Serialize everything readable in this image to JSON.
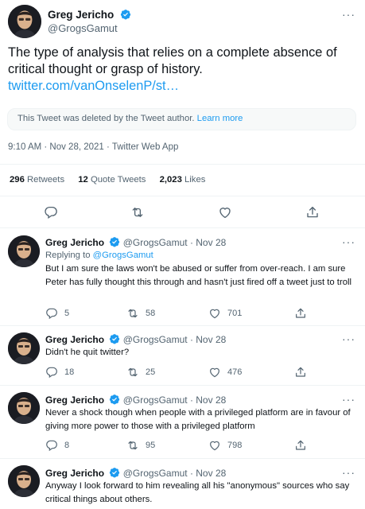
{
  "main_tweet": {
    "author_name": "Greg Jericho",
    "author_handle": "@GrogsGamut",
    "more": "···",
    "text": "The type of analysis that relies on a complete absence of critical thought or grasp of history.",
    "link": "twitter.com/vanOnselenP/st…",
    "deleted_notice": "This Tweet was deleted by the Tweet author.",
    "learn_more": "Learn more",
    "timestamp": "9:10 AM · Nov 28, 2021 · Twitter Web App",
    "stats": {
      "retweets_count": "296",
      "retweets_label": "Retweets",
      "quotes_count": "12",
      "quotes_label": "Quote Tweets",
      "likes_count": "2,023",
      "likes_label": "Likes"
    }
  },
  "replies": [
    {
      "author_name": "Greg Jericho",
      "author_handle": "@GrogsGamut",
      "date": "· Nov 28",
      "replying_to_prefix": "Replying to",
      "replying_to_handle": "@GrogsGamut",
      "text": "But I am sure the laws won't be abused or suffer from over-reach. I am sure Peter has fully thought this through and hasn't just fired off a tweet just to troll",
      "reply_count": "5",
      "retweet_count": "58",
      "like_count": "701"
    },
    {
      "author_name": "Greg Jericho",
      "author_handle": "@GrogsGamut",
      "date": "· Nov 28",
      "text": "Didn't he quit twitter?",
      "reply_count": "18",
      "retweet_count": "25",
      "like_count": "476"
    },
    {
      "author_name": "Greg Jericho",
      "author_handle": "@GrogsGamut",
      "date": "· Nov 28",
      "text": "Never a shock though when people with a privileged platform are in favour of giving more power to those with a privileged platform",
      "reply_count": "8",
      "retweet_count": "95",
      "like_count": "798"
    },
    {
      "author_name": "Greg Jericho",
      "author_handle": "@GrogsGamut",
      "date": "· Nov 28",
      "text": "Anyway I look forward to him revealing all his \"anonymous\" sources who say critical things about others."
    }
  ],
  "colors": {
    "accent": "#1d9bf0",
    "text": "#0f1419",
    "muted": "#536471",
    "divider": "#eff3f4"
  },
  "icons": [
    "verified-badge-icon",
    "more-icon",
    "reply-icon",
    "retweet-icon",
    "like-icon",
    "share-icon"
  ]
}
